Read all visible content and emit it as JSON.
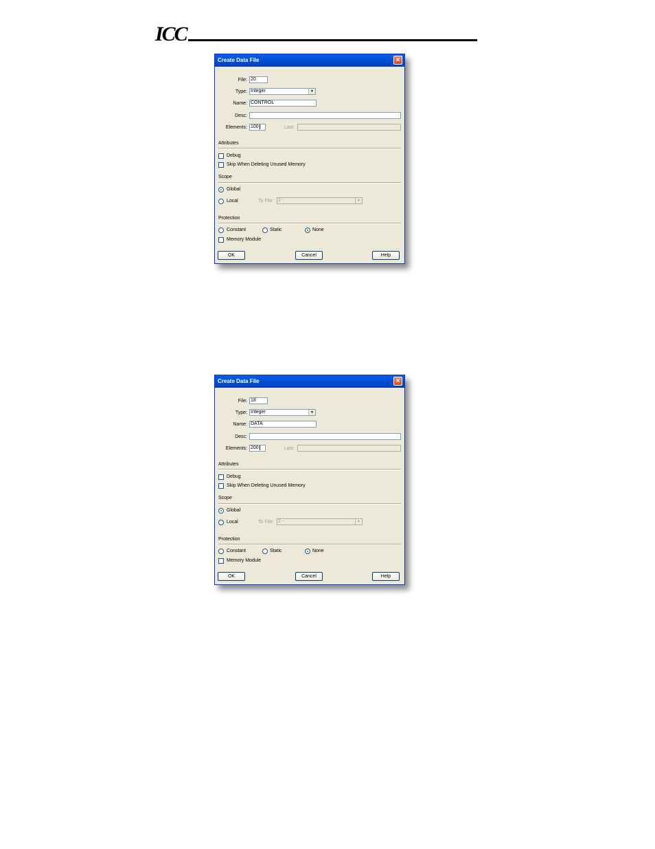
{
  "header": {
    "logo_text": "ICC"
  },
  "dialogs": [
    {
      "title": "Create Data File",
      "close_icon": "close-x-icon",
      "fields": {
        "file_label": "File:",
        "file_value": "20",
        "type_label": "Type:",
        "type_value": "Integer",
        "name_label": "Name:",
        "name_value": "CONTROL",
        "desc_label": "Desc:",
        "desc_value": "",
        "elements_label": "Elements:",
        "elements_value": "100",
        "last_label": "Last:",
        "last_value": ""
      },
      "attributes": {
        "label": "Attributes",
        "debug_label": "Debug",
        "debug_checked": false,
        "skip_label": "Skip When Deleting Unused Memory",
        "skip_checked": false
      },
      "scope": {
        "label": "Scope",
        "global_label": "Global",
        "global_selected": true,
        "local_label": "Local",
        "local_selected": false,
        "to_file_label": "To File:",
        "to_file_value": "2 -"
      },
      "protection": {
        "label": "Protection",
        "constant_label": "Constant",
        "static_label": "Static",
        "none_label": "None",
        "selected": "None",
        "memory_module_label": "Memory Module",
        "memory_module_checked": false
      },
      "buttons": {
        "ok": "OK",
        "cancel": "Cancel",
        "help": "Help"
      }
    },
    {
      "title": "Create Data File",
      "close_icon": "close-x-icon",
      "fields": {
        "file_label": "File:",
        "file_value": "18",
        "type_label": "Type:",
        "type_value": "Integer",
        "name_label": "Name:",
        "name_value": "DATA",
        "desc_label": "Desc:",
        "desc_value": "",
        "elements_label": "Elements:",
        "elements_value": "200",
        "last_label": "Last:",
        "last_value": ""
      },
      "attributes": {
        "label": "Attributes",
        "debug_label": "Debug",
        "debug_checked": false,
        "skip_label": "Skip When Deleting Unused Memory",
        "skip_checked": false
      },
      "scope": {
        "label": "Scope",
        "global_label": "Global",
        "global_selected": true,
        "local_label": "Local",
        "local_selected": false,
        "to_file_label": "To File:",
        "to_file_value": "2 -"
      },
      "protection": {
        "label": "Protection",
        "constant_label": "Constant",
        "static_label": "Static",
        "none_label": "None",
        "selected": "None",
        "memory_module_label": "Memory Module",
        "memory_module_checked": false
      },
      "buttons": {
        "ok": "OK",
        "cancel": "Cancel",
        "help": "Help"
      }
    }
  ]
}
